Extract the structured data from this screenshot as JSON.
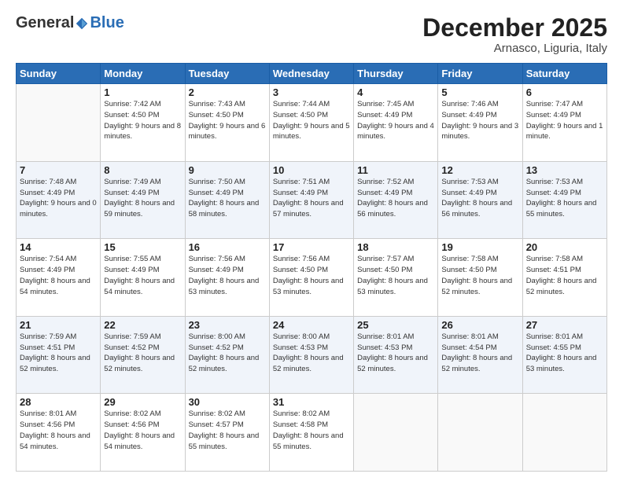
{
  "logo": {
    "general": "General",
    "blue": "Blue"
  },
  "header": {
    "month": "December 2025",
    "location": "Arnasco, Liguria, Italy"
  },
  "weekdays": [
    "Sunday",
    "Monday",
    "Tuesday",
    "Wednesday",
    "Thursday",
    "Friday",
    "Saturday"
  ],
  "weeks": [
    [
      {
        "day": "",
        "info": ""
      },
      {
        "day": "1",
        "info": "Sunrise: 7:42 AM\nSunset: 4:50 PM\nDaylight: 9 hours\nand 8 minutes."
      },
      {
        "day": "2",
        "info": "Sunrise: 7:43 AM\nSunset: 4:50 PM\nDaylight: 9 hours\nand 6 minutes."
      },
      {
        "day": "3",
        "info": "Sunrise: 7:44 AM\nSunset: 4:50 PM\nDaylight: 9 hours\nand 5 minutes."
      },
      {
        "day": "4",
        "info": "Sunrise: 7:45 AM\nSunset: 4:49 PM\nDaylight: 9 hours\nand 4 minutes."
      },
      {
        "day": "5",
        "info": "Sunrise: 7:46 AM\nSunset: 4:49 PM\nDaylight: 9 hours\nand 3 minutes."
      },
      {
        "day": "6",
        "info": "Sunrise: 7:47 AM\nSunset: 4:49 PM\nDaylight: 9 hours\nand 1 minute."
      }
    ],
    [
      {
        "day": "7",
        "info": "Sunrise: 7:48 AM\nSunset: 4:49 PM\nDaylight: 9 hours\nand 0 minutes."
      },
      {
        "day": "8",
        "info": "Sunrise: 7:49 AM\nSunset: 4:49 PM\nDaylight: 8 hours\nand 59 minutes."
      },
      {
        "day": "9",
        "info": "Sunrise: 7:50 AM\nSunset: 4:49 PM\nDaylight: 8 hours\nand 58 minutes."
      },
      {
        "day": "10",
        "info": "Sunrise: 7:51 AM\nSunset: 4:49 PM\nDaylight: 8 hours\nand 57 minutes."
      },
      {
        "day": "11",
        "info": "Sunrise: 7:52 AM\nSunset: 4:49 PM\nDaylight: 8 hours\nand 56 minutes."
      },
      {
        "day": "12",
        "info": "Sunrise: 7:53 AM\nSunset: 4:49 PM\nDaylight: 8 hours\nand 56 minutes."
      },
      {
        "day": "13",
        "info": "Sunrise: 7:53 AM\nSunset: 4:49 PM\nDaylight: 8 hours\nand 55 minutes."
      }
    ],
    [
      {
        "day": "14",
        "info": "Sunrise: 7:54 AM\nSunset: 4:49 PM\nDaylight: 8 hours\nand 54 minutes."
      },
      {
        "day": "15",
        "info": "Sunrise: 7:55 AM\nSunset: 4:49 PM\nDaylight: 8 hours\nand 54 minutes."
      },
      {
        "day": "16",
        "info": "Sunrise: 7:56 AM\nSunset: 4:49 PM\nDaylight: 8 hours\nand 53 minutes."
      },
      {
        "day": "17",
        "info": "Sunrise: 7:56 AM\nSunset: 4:50 PM\nDaylight: 8 hours\nand 53 minutes."
      },
      {
        "day": "18",
        "info": "Sunrise: 7:57 AM\nSunset: 4:50 PM\nDaylight: 8 hours\nand 53 minutes."
      },
      {
        "day": "19",
        "info": "Sunrise: 7:58 AM\nSunset: 4:50 PM\nDaylight: 8 hours\nand 52 minutes."
      },
      {
        "day": "20",
        "info": "Sunrise: 7:58 AM\nSunset: 4:51 PM\nDaylight: 8 hours\nand 52 minutes."
      }
    ],
    [
      {
        "day": "21",
        "info": "Sunrise: 7:59 AM\nSunset: 4:51 PM\nDaylight: 8 hours\nand 52 minutes."
      },
      {
        "day": "22",
        "info": "Sunrise: 7:59 AM\nSunset: 4:52 PM\nDaylight: 8 hours\nand 52 minutes."
      },
      {
        "day": "23",
        "info": "Sunrise: 8:00 AM\nSunset: 4:52 PM\nDaylight: 8 hours\nand 52 minutes."
      },
      {
        "day": "24",
        "info": "Sunrise: 8:00 AM\nSunset: 4:53 PM\nDaylight: 8 hours\nand 52 minutes."
      },
      {
        "day": "25",
        "info": "Sunrise: 8:01 AM\nSunset: 4:53 PM\nDaylight: 8 hours\nand 52 minutes."
      },
      {
        "day": "26",
        "info": "Sunrise: 8:01 AM\nSunset: 4:54 PM\nDaylight: 8 hours\nand 52 minutes."
      },
      {
        "day": "27",
        "info": "Sunrise: 8:01 AM\nSunset: 4:55 PM\nDaylight: 8 hours\nand 53 minutes."
      }
    ],
    [
      {
        "day": "28",
        "info": "Sunrise: 8:01 AM\nSunset: 4:56 PM\nDaylight: 8 hours\nand 54 minutes."
      },
      {
        "day": "29",
        "info": "Sunrise: 8:02 AM\nSunset: 4:56 PM\nDaylight: 8 hours\nand 54 minutes."
      },
      {
        "day": "30",
        "info": "Sunrise: 8:02 AM\nSunset: 4:57 PM\nDaylight: 8 hours\nand 55 minutes."
      },
      {
        "day": "31",
        "info": "Sunrise: 8:02 AM\nSunset: 4:58 PM\nDaylight: 8 hours\nand 55 minutes."
      },
      {
        "day": "",
        "info": ""
      },
      {
        "day": "",
        "info": ""
      },
      {
        "day": "",
        "info": ""
      }
    ]
  ]
}
